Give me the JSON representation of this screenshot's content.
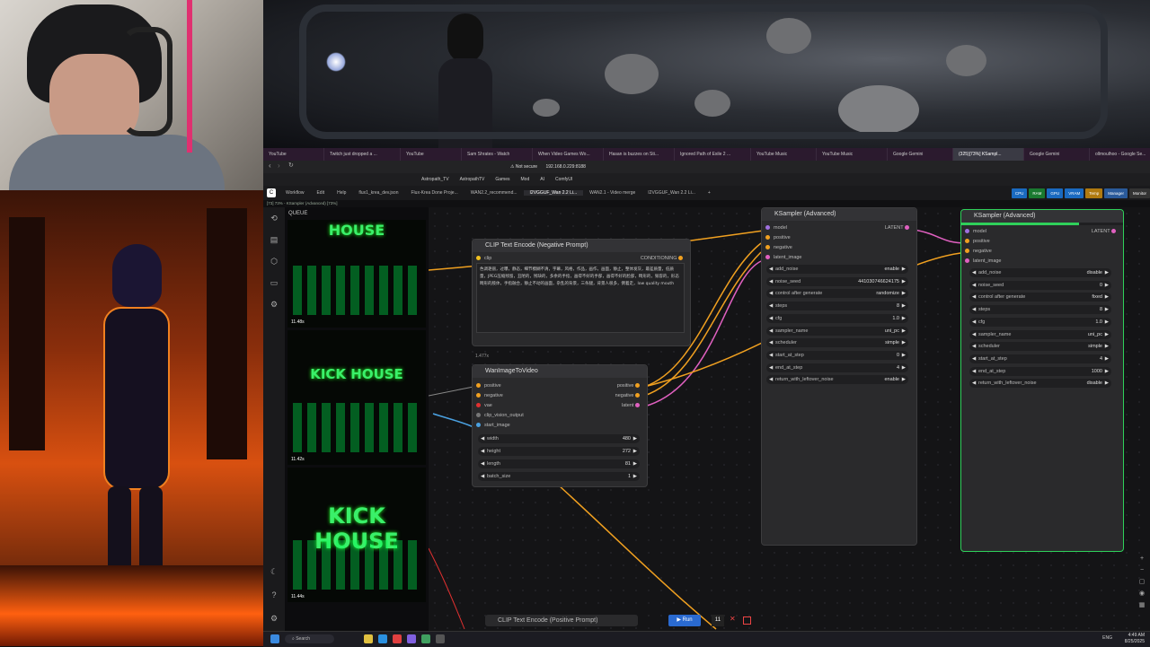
{
  "browser": {
    "tabs": [
      "YouTube",
      "Twitch just dropped a ...",
      "YouTube",
      "Sam Shrates - Watch",
      "When Video Games Wo...",
      "Hasan is buzzes on Sti...",
      "Ignored Path of Exile 2 ...",
      "YouTube Music",
      "YouTube Music",
      "Google Gemini",
      "(325)[73%] KSampl...",
      "Google Gemini",
      "ollmoulhoo - Google Se..."
    ],
    "active_tab_index": 10,
    "address": {
      "security": "Not secure",
      "url": "192.168.0.229:8188"
    },
    "bookmarks": [
      "Astropath_TV",
      "AstropathTV",
      "Games",
      "Mod",
      "AI",
      "ComfyUI"
    ]
  },
  "comfy": {
    "menu": [
      "Workflow",
      "Edit",
      "Help"
    ],
    "workflow_tabs": [
      "flux1_krea_dev.json",
      "Flux-Krea Done Proje...",
      "WAN2.2_recommend...",
      "I2VGGUF_Wan 2.2 Li...",
      "WAN2.1 - Video merge",
      "I2VGGUF_Wan 2.2 Li..."
    ],
    "active_workflow_tab": 3,
    "monitor": [
      "CPU",
      "RAM",
      "GPU",
      "VRAM",
      "Temp"
    ],
    "manager_label": "Manager",
    "monitor_label": "Monitor",
    "status_line": "[73] 73% - KSampler (Advanced) [73%]",
    "queue_label": "QUEUE",
    "queue_items": [
      {
        "title": "HOUSE",
        "time": "11.48s"
      },
      {
        "title": "KICK HOUSE",
        "time": "11.42s"
      },
      {
        "title": "KICK HOUSE",
        "time": "11.44s"
      }
    ],
    "nodes": {
      "clip_negative": {
        "title": "CLIP Text Encode (Negative Prompt)",
        "input": "clip",
        "output": "CONDITIONING",
        "text": "色调艳丽，过曝，静态，细节模糊不清，字幕，风格，作品，画作，画面，静止，整体发灰，最差质量，低质量，JPEG压缩残留，丑陋的，残缺的，多余的手指，画得不好的手部，画得不好的脸部，畸形的，毁容的，形态畸形的肢体，手指融合，静止不动的画面，杂乱的背景，三条腿，背景人很多，倒着走，low quality mouth"
      },
      "wan_i2v": {
        "title": "WanImageToVideo",
        "zoom": "1.477x",
        "inputs": [
          "positive",
          "negative",
          "vae",
          "clip_vision_output",
          "start_image"
        ],
        "outputs": [
          "positive",
          "negative",
          "latent"
        ],
        "widgets": [
          {
            "label": "width",
            "value": "480"
          },
          {
            "label": "height",
            "value": "272"
          },
          {
            "label": "length",
            "value": "81"
          },
          {
            "label": "batch_size",
            "value": "1"
          }
        ]
      },
      "ksampler1": {
        "title": "KSampler (Advanced)",
        "inputs": [
          "model",
          "positive",
          "negative",
          "latent_image"
        ],
        "output": "LATENT",
        "widgets": [
          {
            "label": "add_noise",
            "value": "enable"
          },
          {
            "label": "noise_seed",
            "value": "441030746624175"
          },
          {
            "label": "control after generate",
            "value": "randomize"
          },
          {
            "label": "steps",
            "value": "8"
          },
          {
            "label": "cfg",
            "value": "1.0"
          },
          {
            "label": "sampler_name",
            "value": "uni_pc"
          },
          {
            "label": "scheduler",
            "value": "simple"
          },
          {
            "label": "start_at_step",
            "value": "0"
          },
          {
            "label": "end_at_step",
            "value": "4"
          },
          {
            "label": "return_with_leftover_noise",
            "value": "enable"
          }
        ]
      },
      "ksampler2": {
        "title": "KSampler (Advanced)",
        "inputs": [
          "model",
          "positive",
          "negative",
          "latent_image"
        ],
        "output": "LATENT",
        "progress": 0.73,
        "widgets": [
          {
            "label": "add_noise",
            "value": "disable"
          },
          {
            "label": "noise_seed",
            "value": "0"
          },
          {
            "label": "control after generate",
            "value": "fixed"
          },
          {
            "label": "steps",
            "value": "8"
          },
          {
            "label": "cfg",
            "value": "1.0"
          },
          {
            "label": "sampler_name",
            "value": "uni_pc"
          },
          {
            "label": "scheduler",
            "value": "simple"
          },
          {
            "label": "start_at_step",
            "value": "4"
          },
          {
            "label": "end_at_step",
            "value": "1000"
          },
          {
            "label": "return_with_leftover_noise",
            "value": "disable"
          }
        ]
      },
      "clip_positive": {
        "title": "CLIP Text Encode (Positive Prompt)"
      }
    },
    "run": {
      "label": "Run",
      "count": "11"
    }
  },
  "taskbar": {
    "search": "Search",
    "time": "4:49 AM",
    "date": "8/25/2025",
    "lang": "ENG"
  },
  "colors": {
    "accent_green": "#2fd05a",
    "link_yellow": "#f0a020",
    "link_pink": "#e060c0",
    "link_blue": "#4aa0e0"
  }
}
